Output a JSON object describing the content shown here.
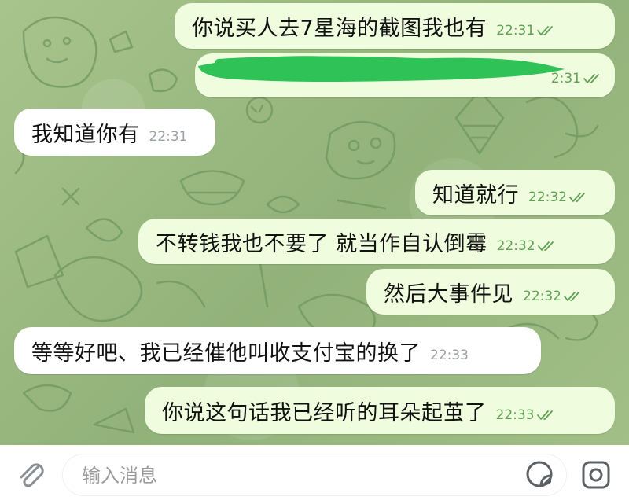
{
  "colors": {
    "outgoing_bubble": "#effdde",
    "incoming_bubble": "#ffffff",
    "read_ticks": "#5fa155",
    "wallpaper": "#9cbc82",
    "redaction": "#2ec257"
  },
  "messages": [
    {
      "direction": "out",
      "text": "你说买人去7星海的截图我也有",
      "time": "22:31",
      "status": "read"
    },
    {
      "direction": "out",
      "text": "",
      "time": "2:31",
      "status": "read",
      "redacted": true
    },
    {
      "direction": "in",
      "text": "我知道你有",
      "time": "22:31"
    },
    {
      "direction": "out",
      "text": "知道就行",
      "time": "22:32",
      "status": "read"
    },
    {
      "direction": "out",
      "text": "不转钱我也不要了 就当作自认倒霉",
      "time": "22:32",
      "status": "read"
    },
    {
      "direction": "out",
      "text": "然后大事件见",
      "time": "22:32",
      "status": "read"
    },
    {
      "direction": "in",
      "text": "等等好吧、我已经催他叫收支付宝的换了",
      "time": "22:33"
    },
    {
      "direction": "out",
      "text": "你说这句话我已经听的耳朵起茧了",
      "time": "22:33",
      "status": "read"
    }
  ],
  "composer": {
    "placeholder": "输入消息",
    "value": "",
    "attach_icon": "paperclip-icon",
    "sticker_icon": "sticker-icon",
    "camera_icon": "camera-icon"
  }
}
